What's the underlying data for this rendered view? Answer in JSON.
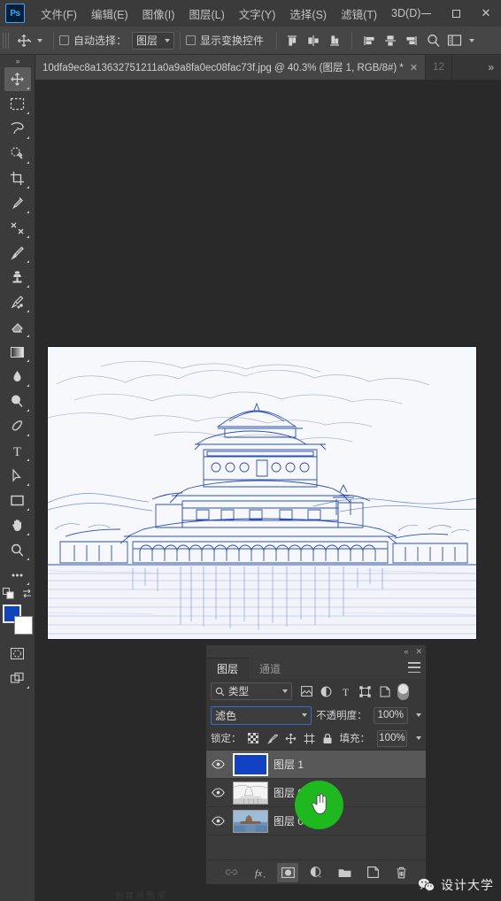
{
  "app": {
    "logo": "Ps",
    "window_controls": {
      "minimize": "minimize-icon",
      "maximize": "maximize-icon",
      "close": "✕"
    }
  },
  "menubar": {
    "items": [
      {
        "label": "文件(F)"
      },
      {
        "label": "编辑(E)"
      },
      {
        "label": "图像(I)"
      },
      {
        "label": "图层(L)"
      },
      {
        "label": "文字(Y)"
      },
      {
        "label": "选择(S)"
      },
      {
        "label": "滤镜(T)"
      },
      {
        "label": "3D(D)"
      }
    ]
  },
  "options_bar": {
    "tool_icon": "move-tool-icon",
    "auto_select_label": "自动选择：",
    "auto_select_checked": false,
    "auto_select_scope": "图层",
    "show_transform_label": "显示变换控件",
    "show_transform_checked": false,
    "align_icons": [
      "align-top-icon",
      "align-vertical-center-icon",
      "align-bottom-icon",
      "align-left-icon",
      "align-horizontal-center-icon",
      "align-right-icon"
    ],
    "search_icon": "search-icon",
    "workspace_icon": "workspace-icon",
    "workspace_caret": "chevron-down-icon"
  },
  "tabbar": {
    "expand_arrows": "»",
    "tabs": [
      {
        "title": "10dfa9ec8a13632751211a0a9a8fa0ec08fac73f.jpg @ 40.3% (图层 1, RGB/8#) *",
        "close": "✕",
        "active": true
      },
      {
        "title": "12",
        "active": false
      }
    ],
    "overflow": "»"
  },
  "toolbar": {
    "expand": "»",
    "tools": [
      {
        "name": "move-tool",
        "active": true
      },
      {
        "name": "rectangular-marquee-tool",
        "active": false
      },
      {
        "name": "lasso-tool",
        "active": false
      },
      {
        "name": "quick-selection-tool",
        "active": false
      },
      {
        "name": "crop-tool",
        "active": false
      },
      {
        "name": "eyedropper-tool",
        "active": false
      },
      {
        "name": "healing-brush-tool",
        "active": false
      },
      {
        "name": "brush-tool",
        "active": false
      },
      {
        "name": "clone-stamp-tool",
        "active": false
      },
      {
        "name": "history-brush-tool",
        "active": false
      },
      {
        "name": "eraser-tool",
        "active": false
      },
      {
        "name": "gradient-tool",
        "active": false
      },
      {
        "name": "blur-tool",
        "active": false
      },
      {
        "name": "dodge-tool",
        "active": false
      },
      {
        "name": "pen-tool",
        "active": false
      },
      {
        "name": "type-tool",
        "active": false
      },
      {
        "name": "path-selection-tool",
        "active": false
      },
      {
        "name": "rectangle-tool",
        "active": false
      },
      {
        "name": "hand-tool",
        "active": false
      },
      {
        "name": "zoom-tool",
        "active": false
      },
      {
        "name": "edit-toolbar-tool",
        "active": false
      }
    ],
    "foreground_color": "#1144bb",
    "background_color": "#ffffff",
    "quick_mask": "quick-mask-icon",
    "screen_mode": "screen-mode-icon"
  },
  "canvas": {
    "image_alt": "blue-pen-sketch-of-chinese-palace-reflected-in-lake",
    "zoom": "40.3%"
  },
  "layers_panel": {
    "collapse": "«",
    "close": "✕",
    "tabs": [
      {
        "label": "图层",
        "active": true
      },
      {
        "label": "通道",
        "active": false
      }
    ],
    "panel_menu": "panel-menu-icon",
    "filter": {
      "search_icon": "search-icon",
      "kind_label": "类型",
      "icons": [
        "filter-pixel-icon",
        "filter-adjustment-icon",
        "filter-type-icon",
        "filter-shape-icon",
        "filter-smart-object-icon"
      ],
      "toggle_on": true
    },
    "blend_mode": "滤色",
    "opacity_label": "不透明度：",
    "opacity_value": "100%",
    "lock_label": "锁定：",
    "lock_icons": [
      "lock-transparent-pixels-icon",
      "lock-image-pixels-icon",
      "lock-position-icon",
      "lock-artboard-nesting-icon",
      "lock-all-icon"
    ],
    "fill_label": "填充：",
    "fill_value": "100%",
    "layers": [
      {
        "name": "图层 1",
        "visible": true,
        "selected": true,
        "thumb": "solid-blue"
      },
      {
        "name": "图层 0 拷贝",
        "visible": true,
        "selected": false,
        "thumb": "gray-sketch"
      },
      {
        "name": "图层 0",
        "visible": true,
        "selected": false,
        "thumb": "color-photo"
      }
    ],
    "bottom_icons": [
      {
        "name": "link-layers-icon",
        "state": "disabled"
      },
      {
        "name": "layer-style-fx-icon",
        "state": "normal"
      },
      {
        "name": "add-layer-mask-icon",
        "state": "active"
      },
      {
        "name": "new-adjustment-layer-icon",
        "state": "normal"
      },
      {
        "name": "new-group-icon",
        "state": "normal"
      },
      {
        "name": "new-layer-icon",
        "state": "normal"
      },
      {
        "name": "delete-layer-icon",
        "state": "normal"
      }
    ]
  },
  "cursor": {
    "icon": "pointing-hand-cursor",
    "glyph": "☜"
  },
  "watermark": {
    "icon": "wechat-icon",
    "text": "设计大学"
  },
  "status_faint": "创建新图层"
}
